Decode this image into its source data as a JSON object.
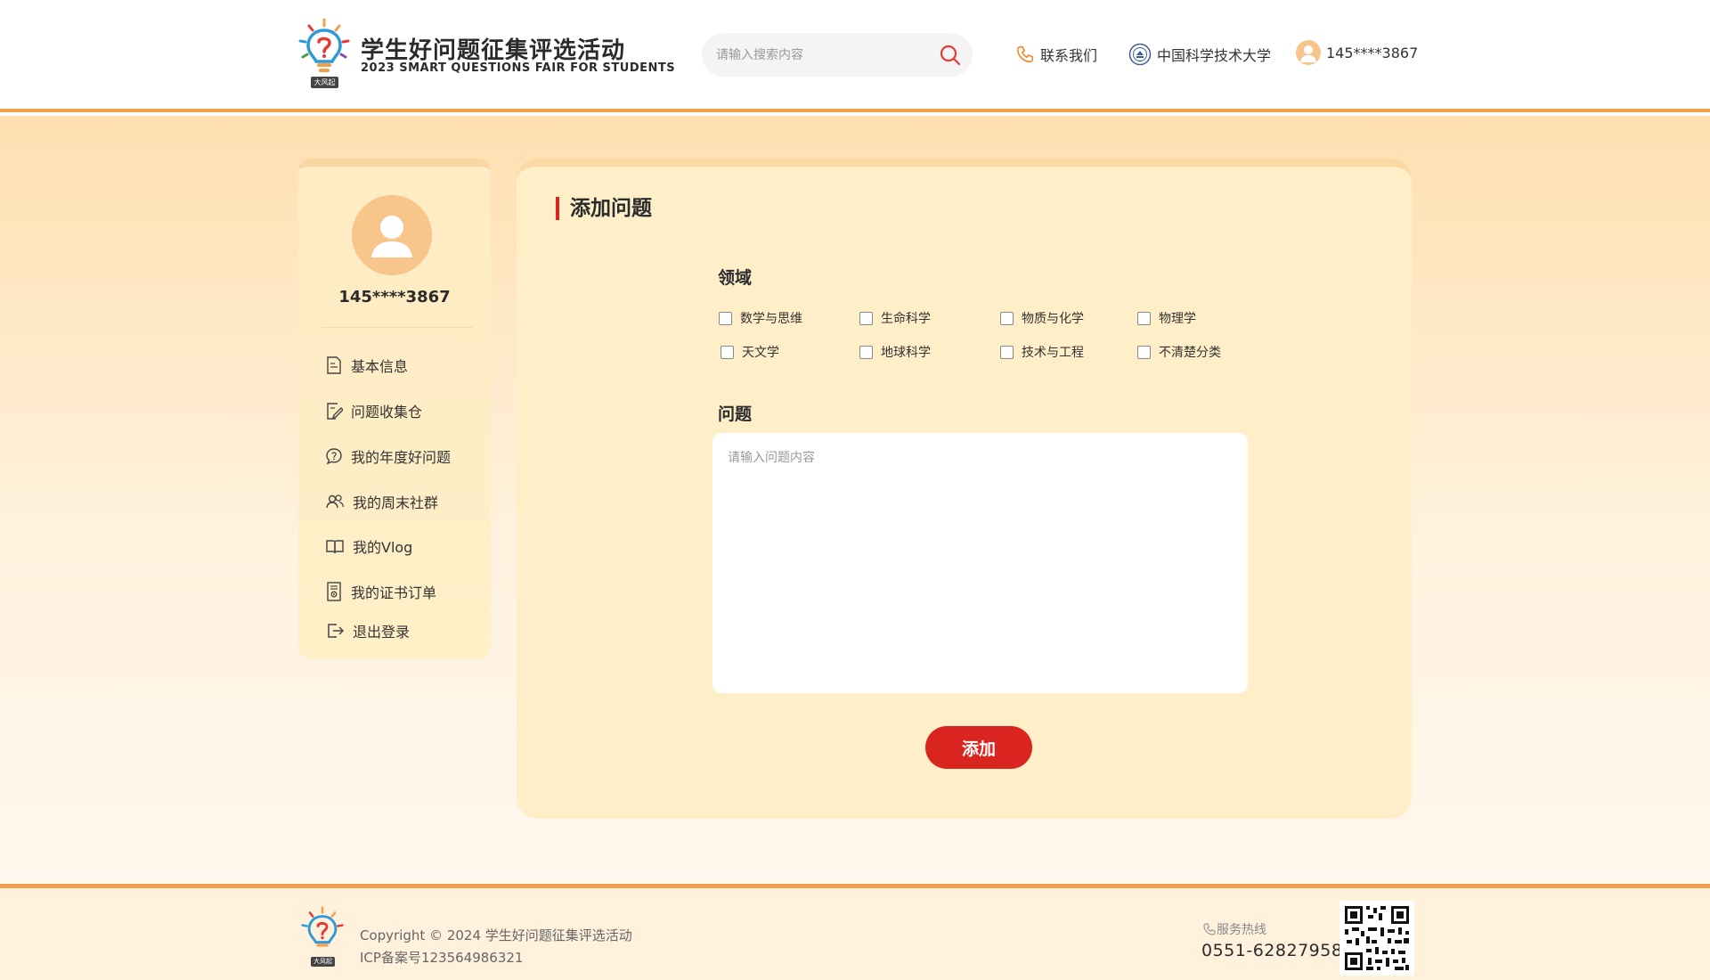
{
  "header": {
    "title": "学生好问题征集评选活动",
    "subtitle": "2023 SMART QUESTIONS FAIR FOR STUDENTS",
    "logo_tag": "大风起",
    "search_placeholder": "请输入搜索内容",
    "contact_label": "联系我们",
    "university_label": "中国科学技术大学",
    "user_label": "145****3867",
    "icons": [
      "search-icon",
      "phone-icon",
      "university-emblem-icon",
      "user-avatar-icon"
    ]
  },
  "sidebar": {
    "username": "145****3867",
    "items": [
      {
        "label": "基本信息",
        "icon": "document-icon"
      },
      {
        "label": "问题收集仓",
        "icon": "edit-icon"
      },
      {
        "label": "我的年度好问题",
        "icon": "question-bubble-icon"
      },
      {
        "label": "我的周末社群",
        "icon": "group-icon"
      },
      {
        "label": "我的Vlog",
        "icon": "book-open-icon"
      },
      {
        "label": "我的证书订单",
        "icon": "certificate-icon"
      },
      {
        "label": "退出登录",
        "icon": "logout-icon"
      }
    ]
  },
  "main": {
    "title": "添加问题",
    "field_label": "领域",
    "fields": [
      {
        "label": "数学与思维",
        "checked": false
      },
      {
        "label": "生命科学",
        "checked": false
      },
      {
        "label": "物质与化学",
        "checked": false
      },
      {
        "label": "物理学",
        "checked": false
      },
      {
        "label": "天文学",
        "checked": false
      },
      {
        "label": "地球科学",
        "checked": false
      },
      {
        "label": "技术与工程",
        "checked": false
      },
      {
        "label": "不清楚分类",
        "checked": false
      }
    ],
    "question_label": "问题",
    "question_placeholder": "请输入问题内容",
    "question_value": "",
    "submit_label": "添加"
  },
  "footer": {
    "logo_tag": "大风起",
    "copyright": "Copyright © 2024 学生好问题征集评选活动",
    "icp": "ICP备案号123564986321",
    "hotline_label": "服务热线",
    "hotline": "0551-62827958"
  },
  "colors": {
    "accent_red": "#d9241f",
    "accent_orange": "#f4a04a",
    "panel_bg": "#feefc9",
    "avatar": "#f8c58b"
  }
}
